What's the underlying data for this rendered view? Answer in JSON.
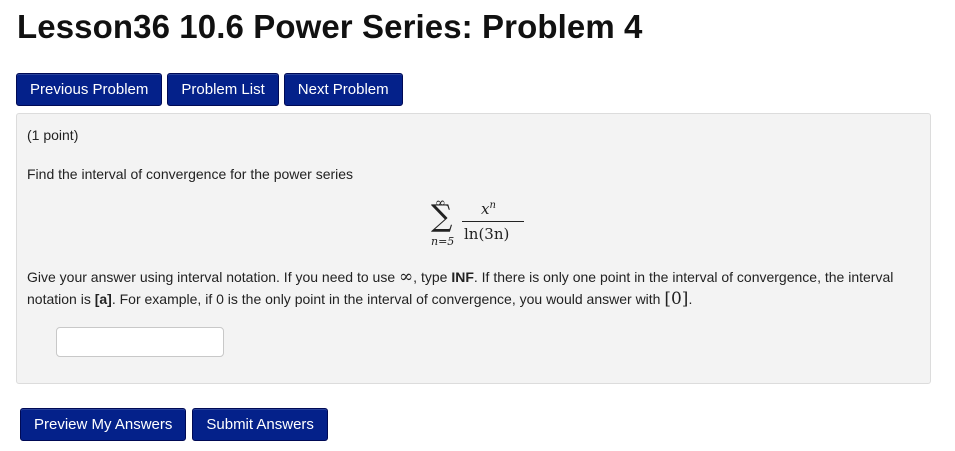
{
  "title": "Lesson36 10.6 Power Series: Problem 4",
  "nav": {
    "previous": "Previous Problem",
    "list": "Problem List",
    "next": "Next Problem"
  },
  "problem": {
    "points": "(1 point)",
    "prompt": "Find the interval of convergence for the power series",
    "formula": {
      "upper": "∞",
      "sigma": "∑",
      "lower": "n=5",
      "numerator_base": "x",
      "numerator_exp": "n",
      "denominator": "ln(3n)"
    },
    "instructions": {
      "t1": "Give your answer using interval notation. If you need to use ",
      "inf_symbol": "∞",
      "t2": ", type ",
      "b1": "INF",
      "t3": ". If there is only one point in the interval of convergence, the interval notation is ",
      "b2": "[a]",
      "t4": ". For example, if 0 is the only point in the interval of convergence, you would answer with ",
      "example": "[0]",
      "t5": "."
    },
    "answer_value": ""
  },
  "actions": {
    "preview": "Preview My Answers",
    "submit": "Submit Answers"
  },
  "colors": {
    "button_bg": "#04218a",
    "panel_bg": "#f3f3f3"
  }
}
